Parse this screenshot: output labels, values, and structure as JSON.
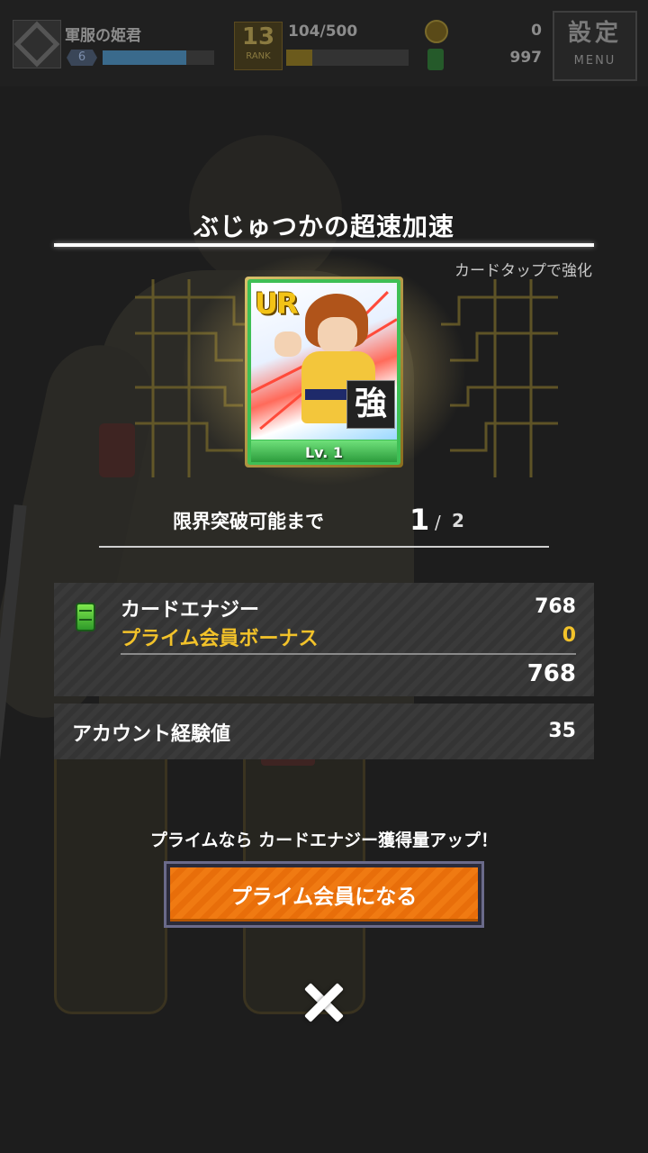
{
  "status_bar": {
    "player_name": "軍服の姫君",
    "player_level": "6",
    "player_level_progress": 0.75,
    "rank_number": "13",
    "rank_label": "RANK",
    "rank_exp": "104/500",
    "rank_exp_progress": 0.21,
    "coins": "0",
    "energy": "997",
    "menu_kanji": "設定",
    "menu_label": "MENU"
  },
  "dialog": {
    "title": "ぶじゅつかの超速加速",
    "tap_hint": "カードタップで強化",
    "card": {
      "rarity": "UR",
      "enhance_badge": "強",
      "level": "Lv. 1"
    },
    "limit_break": {
      "label": "限界突破可能まで",
      "current": "1",
      "separator": "/",
      "max": "2"
    },
    "rewards": {
      "card_energy_label": "カードエナジー",
      "card_energy_value": "768",
      "prime_bonus_label": "プライム会員ボーナス",
      "prime_bonus_value": "0",
      "total_value": "768",
      "account_exp_label": "アカウント経験値",
      "account_exp_value": "35"
    },
    "promo_text": "プライムなら カードエナジー獲得量アップ！",
    "prime_button_label": "プライム会員になる"
  },
  "icons": {
    "guild": "guild-emblem-icon",
    "coin": "coin-icon",
    "energy": "energy-jar-icon",
    "close": "close-icon"
  },
  "colors": {
    "accent_gold": "#f2c22a",
    "button_orange": "#f07a12",
    "card_frame_green": "#3fbf55"
  }
}
